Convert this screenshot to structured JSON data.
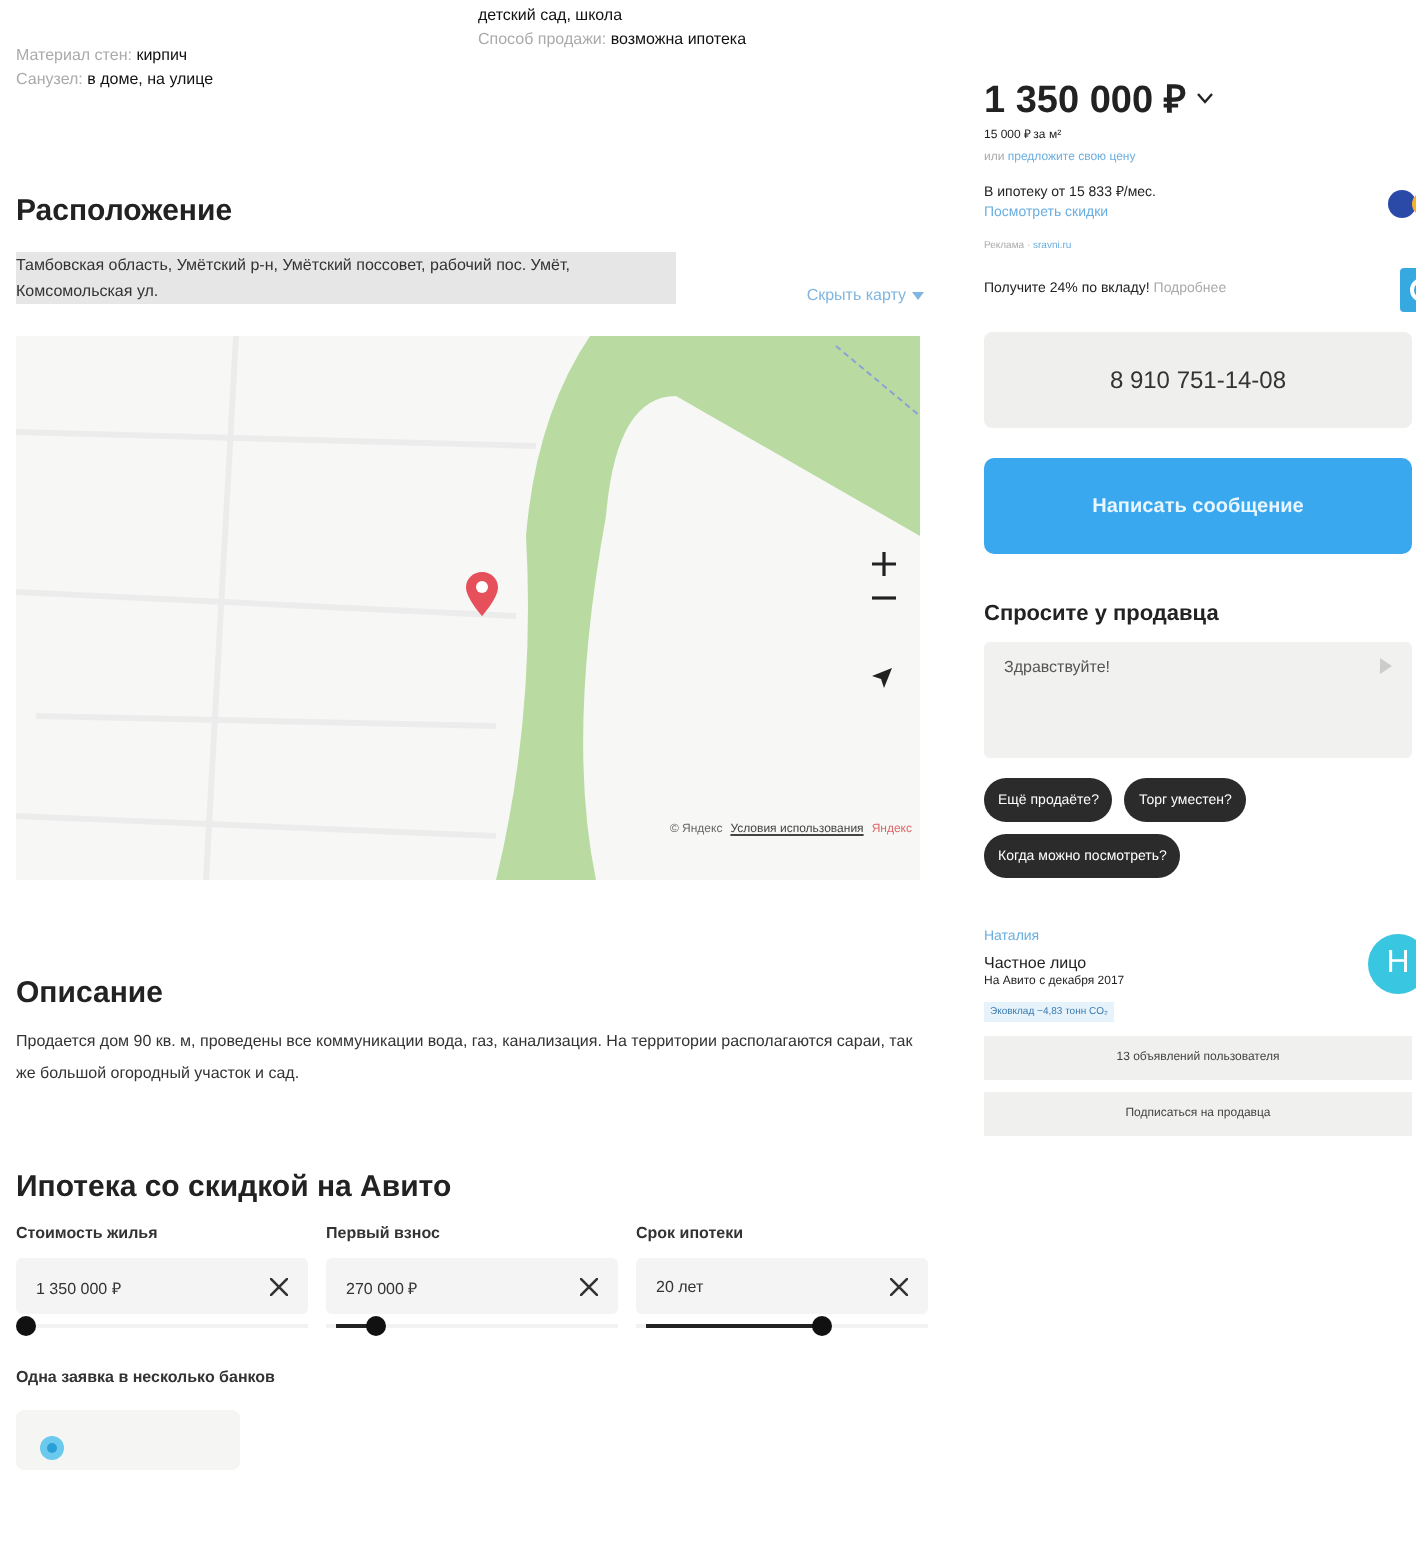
{
  "params": {
    "left": [
      {
        "label": "Материал стен:",
        "value": "кирпич"
      },
      {
        "label": "Санузел:",
        "value": "в доме, на улице"
      }
    ],
    "right": [
      {
        "value": "детский сад, школа"
      },
      {
        "label": "Способ продажи:",
        "value": "возможна ипотека"
      }
    ]
  },
  "location": {
    "title": "Расположение",
    "address": "Тамбовская область, Умётский р-н, Умётский поссовет, рабочий пос. Умёт, Комсомольская ул.",
    "hide_map": "Скрыть карту",
    "attribution": "© Яндекс",
    "terms": "Условия использования",
    "brand": "Яндекс"
  },
  "description": {
    "title": "Описание",
    "text": "Продается дом 90 кв. м, проведены все коммуникации вода, газ, канализация. На территории располагаются сараи, так же большой огородный участок и сад."
  },
  "mortgage": {
    "title": "Ипотека со скидкой на Авито",
    "fields": [
      {
        "label": "Стоимость жилья",
        "value": "1 350 000 ₽",
        "level": 0
      },
      {
        "label": "Первый взнос",
        "value": "270 000 ₽",
        "level": 0.15
      },
      {
        "label": "Срок ипотеки",
        "value": "20 лет",
        "level": 0.65
      }
    ],
    "banks_title": "Одна заявка в несколько банков"
  },
  "sidebar": {
    "price": "1 350 000 ₽",
    "price_per_m": "15 000 ₽ за м²",
    "offer_prefix": "или",
    "offer_link": "предложите свою цену",
    "mortgage_text": "В ипотеку от 15 833 ₽/мес.",
    "discounts_link": "Посмотреть скидки",
    "ad_label": "Реклама ·",
    "ad_site": "sravni.ru",
    "deposit_text": "Получите 24% по вкладу!",
    "deposit_link": "Подробнее",
    "phone": "8 910 751-14-08",
    "message_button": "Написать сообщение",
    "ask_title": "Спросите у продавца",
    "message_value": "Здравствуйте!",
    "chips": [
      "Ещё продаёте?",
      "Торг уместен?",
      "Когда можно посмотреть?"
    ],
    "seller_name": "Наталия",
    "seller_type": "Частное лицо",
    "seller_since": "На Авито с декабря 2017",
    "eco_badge": "Эковклад −4,83 тонн CO₂",
    "avatar_letter": "Н",
    "buttons": [
      "13 объявлений пользователя",
      "Подписаться на продавца"
    ]
  }
}
